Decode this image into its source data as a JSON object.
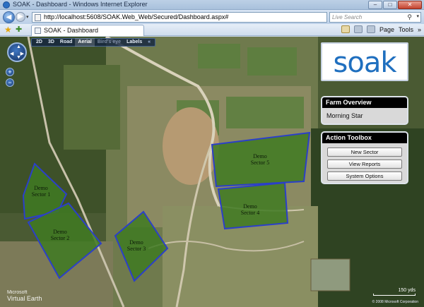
{
  "window": {
    "title": "SOAK - Dashboard - Windows Internet Explorer",
    "min": "–",
    "max": "□",
    "close": "✕"
  },
  "addressbar": {
    "back": "◀",
    "forward": "▶",
    "recent": "▾",
    "url": "http://localhost:5608/SOAK.Web_Web/Secured/Dashboard.aspx#",
    "refresh": "↻",
    "stop": "✕",
    "search_placeholder": "Live Search",
    "search_icon": "⚲",
    "search_drop": "▾"
  },
  "commandbar": {
    "favorites_icon": "★",
    "add_favorite_icon": "✚",
    "tab_label": "SOAK - Dashboard",
    "page_label": "Page",
    "tools_label": "Tools",
    "chevron": "»"
  },
  "map": {
    "view_options": [
      "2D",
      "3D",
      "Road",
      "Aerial",
      "Bird's eye",
      "Labels"
    ],
    "active_view": "Aerial",
    "collapse": "«",
    "zoom_in": "+",
    "zoom_out": "−",
    "brand_line1": "Microsoft",
    "brand_line2": "Virtual Earth",
    "scale_label": "150 yds",
    "copyright": "© 2008 Microsoft Corporation",
    "sectors": [
      {
        "name": "Demo Sector 1",
        "line1": "Demo",
        "line2": "Sector 1"
      },
      {
        "name": "Demo Sector 2",
        "line1": "Demo",
        "line2": "Sector 2"
      },
      {
        "name": "Demo Sector 3",
        "line1": "Demo",
        "line2": "Sector 3"
      },
      {
        "name": "Demo Sector 4",
        "line1": "Demo",
        "line2": "Sector 4"
      },
      {
        "name": "Demo Sector 5",
        "line1": "Demo",
        "line2": "Sector 5"
      }
    ]
  },
  "logo": {
    "text": "soak"
  },
  "farm_overview": {
    "header": "Farm Overview",
    "farm_name": "Morning Star"
  },
  "action_toolbox": {
    "header": "Action Toolbox",
    "buttons": [
      "New Sector",
      "View Reports",
      "System Options"
    ]
  },
  "colors": {
    "sector_fill": "#3f7a22",
    "sector_border": "#2b3fc9",
    "brand_blue": "#1f6fbf"
  }
}
